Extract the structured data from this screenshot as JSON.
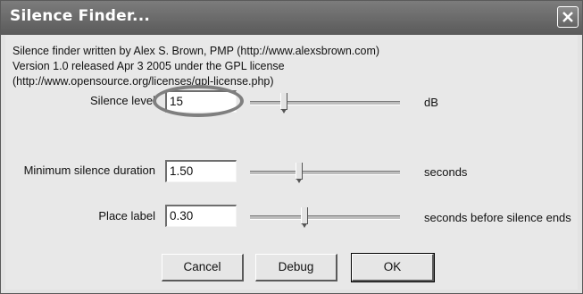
{
  "window": {
    "title": "Silence Finder..."
  },
  "info": {
    "line1": "Silence finder written by Alex S. Brown, PMP (http://www.alexsbrown.com)",
    "line2": "Version 1.0 released Apr 3 2005 under the GPL license",
    "line3": "(http://www.opensource.org/licenses/gpl-license.php)"
  },
  "fields": {
    "silence_level": {
      "label": "Silence level",
      "value": "15",
      "unit": "dB",
      "slider_fraction": 0.22
    },
    "min_duration": {
      "label": "Minimum silence duration",
      "value": "1.50",
      "unit": "seconds",
      "slider_fraction": 0.32
    },
    "place_label": {
      "label": "Place label",
      "value": "0.30",
      "unit": "seconds before silence ends",
      "slider_fraction": 0.36
    }
  },
  "buttons": {
    "cancel": "Cancel",
    "debug": "Debug",
    "ok": "OK"
  }
}
